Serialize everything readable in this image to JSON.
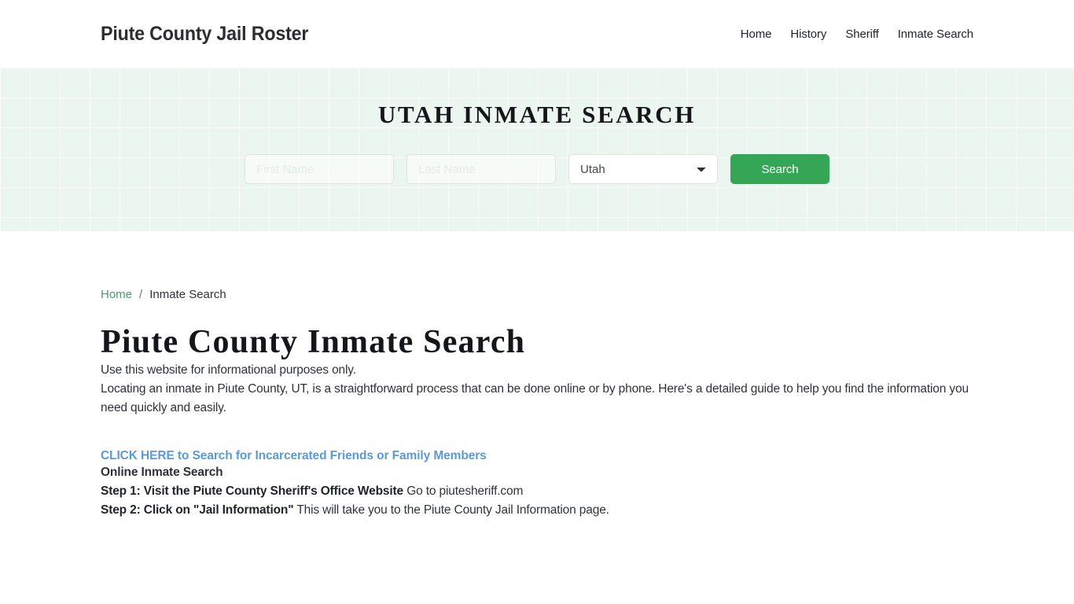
{
  "header": {
    "brand": "Piute County Jail Roster",
    "nav": [
      {
        "label": "Home"
      },
      {
        "label": "History"
      },
      {
        "label": "Sheriff"
      },
      {
        "label": "Inmate Search"
      }
    ]
  },
  "hero": {
    "title": "UTAH INMATE SEARCH",
    "first_name_placeholder": "First Name",
    "first_name_value": "",
    "last_name_placeholder": "Last Name",
    "last_name_value": "",
    "state_selected": "Utah",
    "state_options": [
      "Utah"
    ],
    "search_button": "Search",
    "accent_green": "#35a655",
    "background": "#eaf6ef"
  },
  "breadcrumb": {
    "home": "Home",
    "separator": "/",
    "current": "Inmate Search"
  },
  "page": {
    "title": "Piute County Inmate Search",
    "intro": "Use this website for informational purposes only.",
    "paragraph": "Locating an inmate in Piute County, UT, is a straightforward process that can be done online or by phone. Here's a detailed guide to help you find the information you need quickly and easily.",
    "cta_link": "CLICK HERE to Search for Incarcerated Friends or Family Members",
    "cta_color": "#5a9bd4",
    "section_heading": "Online Inmate Search",
    "step1_bold": "Step 1: Visit the Piute County Sheriff's Office Website",
    "step1_rest": " Go to piutesheriff.com",
    "step2_bold": "Step 2: Click on \"Jail Information\"",
    "step2_rest": " This will take you to the Piute County Jail Information page."
  }
}
